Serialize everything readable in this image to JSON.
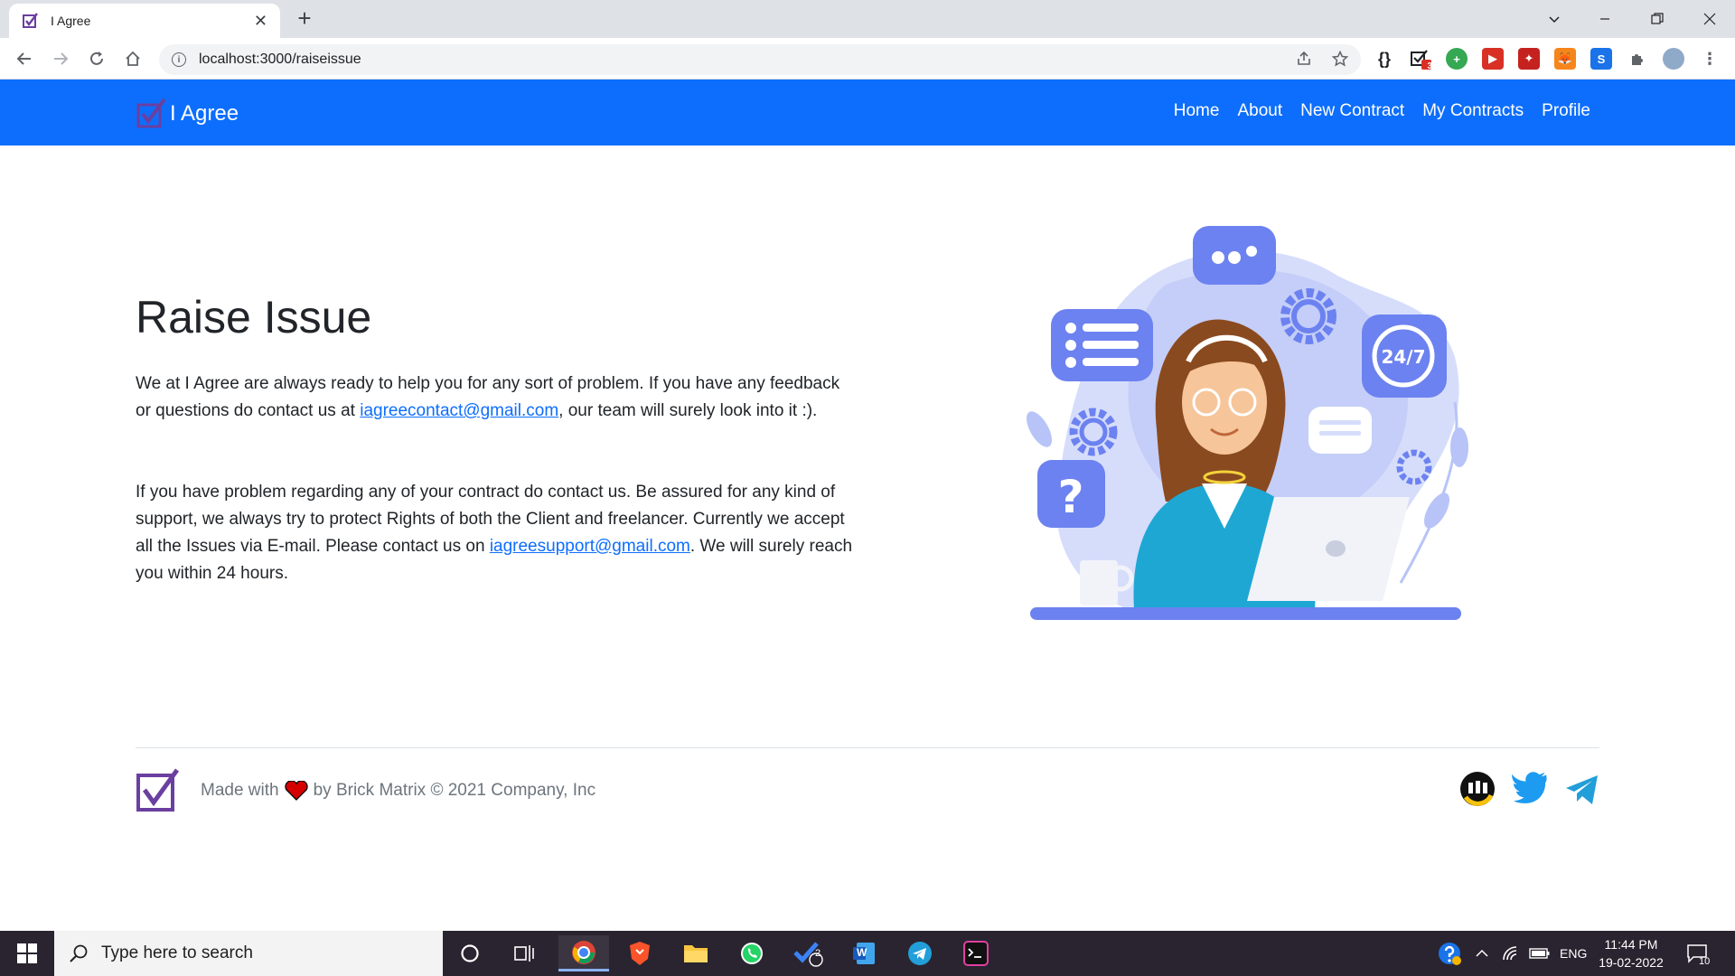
{
  "browser": {
    "tab_title": "I Agree",
    "close_glyph": "✕",
    "new_tab_glyph": "+",
    "url": "localhost:3000/raiseissue",
    "extension_badge": "3"
  },
  "site": {
    "brand": "I Agree",
    "nav": [
      "Home",
      "About",
      "New Contract",
      "My Contracts",
      "Profile"
    ],
    "brand_color": "#0d6efd"
  },
  "main": {
    "title": "Raise Issue",
    "para1_before": "We at I Agree are always ready to help you for any sort of problem. If you have any feedback or questions do contact us at ",
    "para1_link": "iagreecontact@gmail.com",
    "para1_after": ", our team will surely look into it :).",
    "para2_before": "If you have problem regarding any of your contract do contact us. Be assured for any kind of support, we always try to protect Rights of both the Client and freelancer. Currently we accept all the Issues via E-mail. Please contact us on ",
    "para2_link": "iagreesupport@gmail.com",
    "para2_after": ". We will surely reach you within 24 hours.",
    "badge_247": "24/7",
    "question_mark": "?"
  },
  "footer": {
    "made_with": "Made with",
    "by_text": "by Brick Matrix © 2021 Company, Inc"
  },
  "taskbar": {
    "search_placeholder": "Type here to search",
    "time": "11:44 PM",
    "date": "19-02-2022",
    "lang": "ENG",
    "notif_count": "10",
    "todo_badge": "2",
    "word_letter": "W"
  }
}
